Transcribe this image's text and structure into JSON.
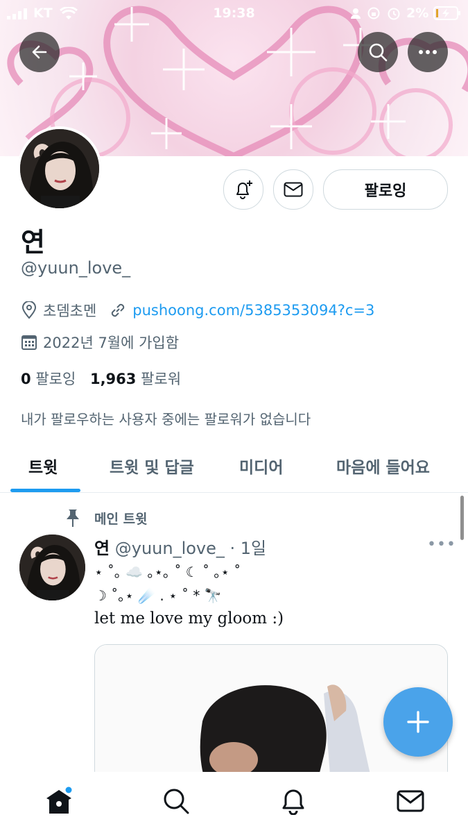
{
  "status_bar": {
    "carrier": "KT",
    "time": "19:38",
    "battery": "2%"
  },
  "profile": {
    "name": "연",
    "handle": "@yuun_love_",
    "location": "초뎀초멘",
    "link": "pushoong.com/5385353094?c=3",
    "joined": "2022년 7월에 가입함",
    "following_count": "0",
    "following_label": "팔로잉",
    "followers_count": "1,963",
    "followers_label": "팔로워",
    "followed_by_note": "내가 팔로우하는 사용자 중에는 팔로워가 없습니다"
  },
  "actions": {
    "following_button": "팔로잉"
  },
  "tabs": [
    {
      "label": "트윗",
      "active": true
    },
    {
      "label": "트윗 및 답글",
      "active": false
    },
    {
      "label": "미디어",
      "active": false
    },
    {
      "label": "마음에 들어요",
      "active": false
    }
  ],
  "tweet": {
    "pinned_label": "메인 트윗",
    "author_name": "연",
    "author_handle": "@yuun_love_",
    "time": "· 1일",
    "deco_line1": "⋆ ˚｡ ☁️ ｡⋆｡ ˚ ☾ ˚ ｡⋆ ˚",
    "deco_line2": "☽ ˚｡⋆ ☄️ . ⋆ ˚ * 🔭",
    "text": "let me love my gloom :)"
  },
  "colors": {
    "accent": "#1d9bf0",
    "fab": "#4aa3ea",
    "banner_pink": "#e58bb8"
  },
  "icons": {
    "back": "arrow-left-icon",
    "search": "search-icon",
    "more": "more-icon",
    "notify": "bell-plus-icon",
    "message": "mail-icon",
    "location": "location-pin-icon",
    "link": "link-icon",
    "calendar": "calendar-icon",
    "pin": "pin-icon",
    "compose": "plus-icon",
    "home": "home-icon",
    "explore": "search-icon",
    "notifications": "bell-icon",
    "messages": "mail-icon"
  }
}
